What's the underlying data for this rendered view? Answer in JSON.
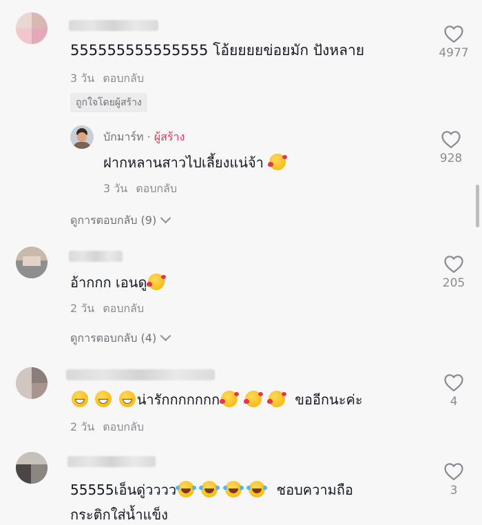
{
  "comments": [
    {
      "text": "555555555555555 โอ้ยยยยข่อยมัก ปังหลาย",
      "time": "3 วัน",
      "reply": "ตอบกลับ",
      "badge": "ถูกใจโดยผู้สร้าง",
      "likes": "4977"
    },
    {
      "text": "อ้ากกก เอนดู",
      "time": "2 วัน",
      "reply": "ตอบกลับ",
      "likes": "205",
      "view_replies": "ดูการตอบกลับ (4)"
    },
    {
      "text": "น่ารักกกกกกก",
      "text_tail": "ขออีกนะค่ะ",
      "time": "2 วัน",
      "reply": "ตอบกลับ",
      "likes": "4"
    },
    {
      "text_line1": "55555เอ็นดู่วววว",
      "text_tail": "ชอบความถือ",
      "text_line2": "กระติกใส่น้ำแข็ง",
      "likes": "3"
    }
  ],
  "creator_reply": {
    "username": "บักมาร์ท",
    "separator": " · ",
    "creator_label": "ผู้สร้าง",
    "text": "ฝากหลานสาวไปเลี้ยงแน่จ้า",
    "time": "3 วัน",
    "reply": "ตอบกลับ",
    "likes": "928",
    "view_replies": "ดูการตอบกลับ (9)"
  },
  "colors": {
    "background": "#f7f7f7",
    "text": "#161823",
    "muted": "#8a8b91",
    "creator_accent": "#fe2c55"
  },
  "icons": [
    "heart-outline-icon",
    "chevron-down-icon"
  ]
}
